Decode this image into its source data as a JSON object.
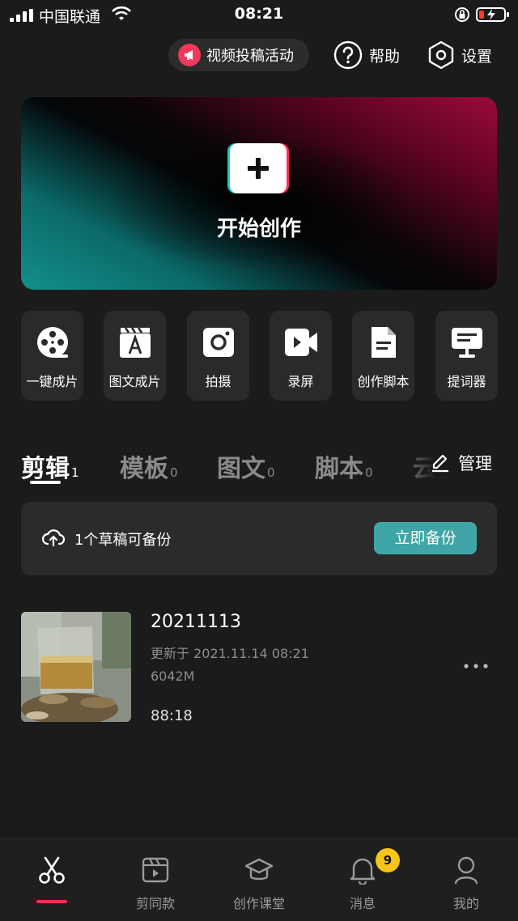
{
  "status_bar": {
    "carrier": "中国联通",
    "time": "08:21"
  },
  "top_actions": {
    "campaign_label": "视频投稿活动",
    "help_label": "帮助",
    "settings_label": "设置"
  },
  "hero": {
    "title": "开始创作"
  },
  "tools": [
    {
      "label": "一键成片",
      "icon": "film-reel-icon"
    },
    {
      "label": "图文成片",
      "icon": "text-clapper-icon"
    },
    {
      "label": "拍摄",
      "icon": "camera-icon"
    },
    {
      "label": "录屏",
      "icon": "screen-record-icon"
    },
    {
      "label": "创作脚本",
      "icon": "script-doc-icon"
    },
    {
      "label": "提词器",
      "icon": "teleprompter-icon"
    }
  ],
  "tabs": [
    {
      "label": "剪辑",
      "count": "1"
    },
    {
      "label": "模板",
      "count": "0"
    },
    {
      "label": "图文",
      "count": "0"
    },
    {
      "label": "脚本",
      "count": "0"
    },
    {
      "label": "云",
      "count": ""
    }
  ],
  "manage_label": "管理",
  "backup": {
    "message": "1个草稿可备份",
    "button": "立即备份"
  },
  "draft": {
    "title": "20211113",
    "updated": "更新于 2021.11.14 08:21",
    "size": "6042M",
    "duration": "88:18"
  },
  "bottom_nav": {
    "items": [
      {
        "label": "",
        "icon": "scissors-icon"
      },
      {
        "label": "剪同款",
        "icon": "template-clapper-icon"
      },
      {
        "label": "创作课堂",
        "icon": "graduation-cap-icon"
      },
      {
        "label": "消息",
        "icon": "bell-icon"
      },
      {
        "label": "我的",
        "icon": "profile-icon"
      }
    ],
    "message_badge": "9"
  },
  "colors": {
    "accent_teal": "#3fa5a6",
    "accent_red": "#fe2c55",
    "badge_yellow": "#f5c518",
    "background": "#1b1b1b"
  }
}
